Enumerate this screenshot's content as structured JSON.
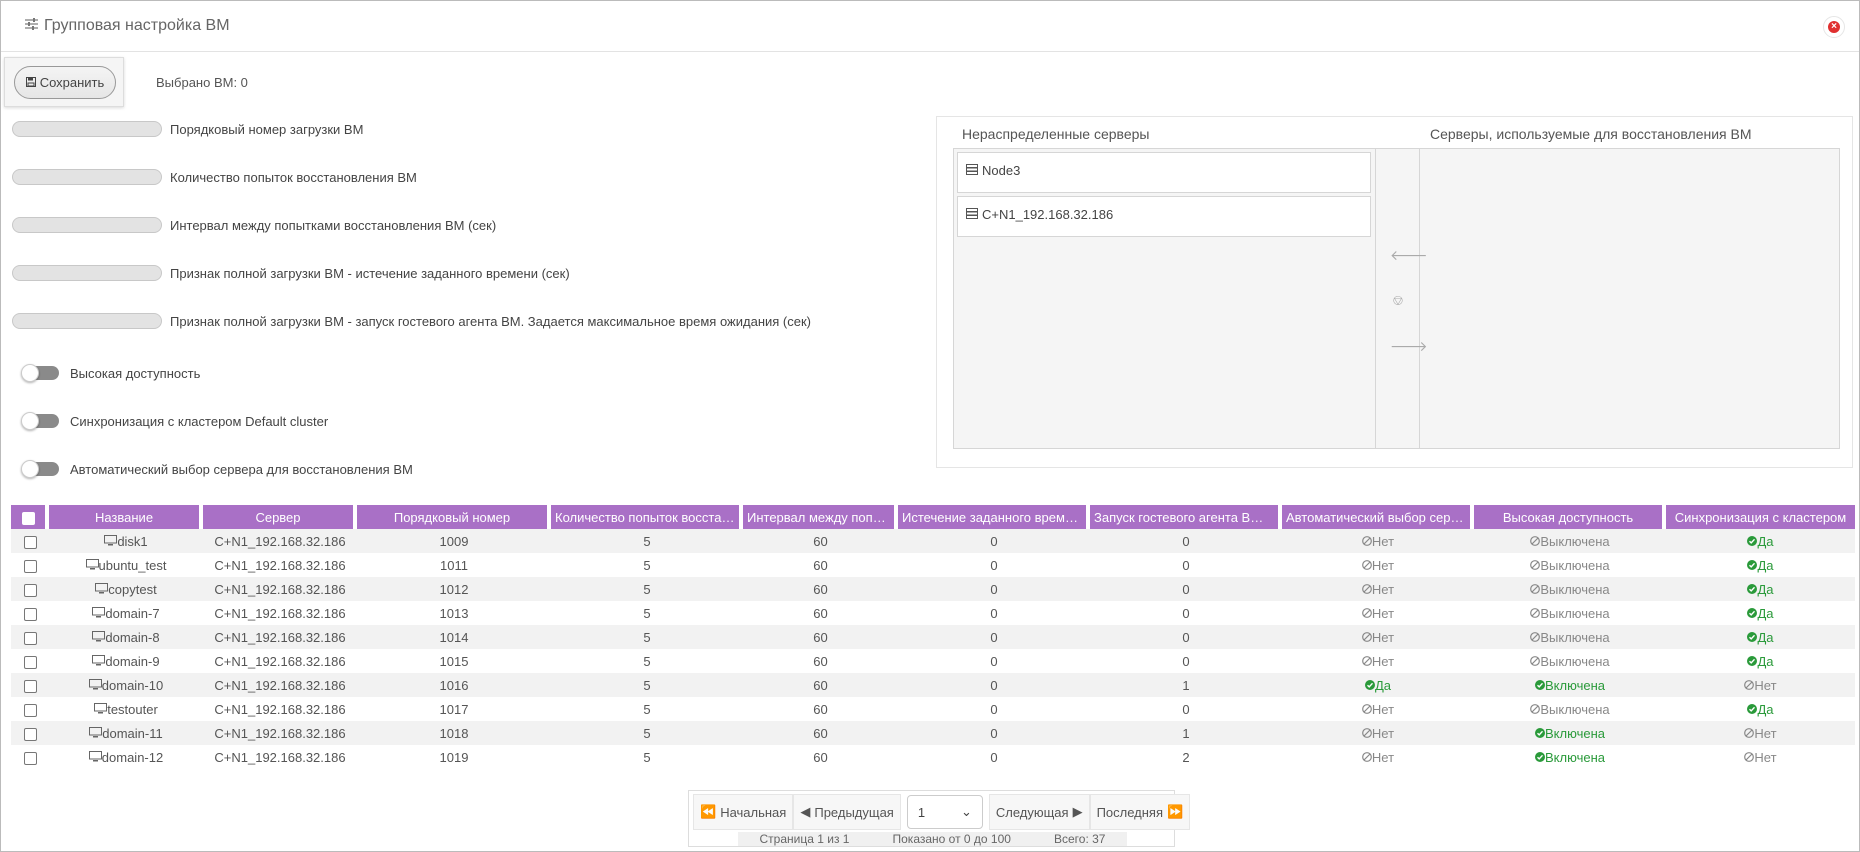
{
  "window": {
    "title": "Групповая настройка ВМ",
    "title_icon": "sliders-icon",
    "close_icon": "close-icon"
  },
  "toolbar": {
    "save_label": "Сохранить",
    "save_icon": "floppy-icon",
    "selected_label": "Выбрано ВМ: 0"
  },
  "fields": [
    "Порядковый номер загрузки ВМ",
    "Количество попыток восстановления ВМ",
    "Интервал между попытками восстановления ВМ (сек)",
    "Признак полной загрузки ВМ - истечение заданного времени (сек)",
    "Признак полной загрузки ВМ - запуск гостевого агента ВМ. Задается максимальное время ожидания (сек)"
  ],
  "toggles": [
    "Высокая доступность",
    "Синхронизация с кластером Default cluster",
    "Автоматический выбор сервера для восстановления ВМ"
  ],
  "servers": {
    "unassigned_title": "Нераспределенные серверы",
    "used_title": "Серверы, используемые для восстановления ВМ",
    "unassigned": [
      "Node3",
      "C+N1_192.168.32.186"
    ],
    "used": []
  },
  "table": {
    "columns": [
      "Название",
      "Сервер",
      "Порядковый номер",
      "Количество попыток восстан...",
      "Интервал между попы...",
      "Истечение заданного време...",
      "Запуск гостевого агента ВМ ...",
      "Автоматический выбор серв...",
      "Высокая доступность",
      "Синхронизация с кластером"
    ],
    "rows": [
      {
        "name": "disk1",
        "server": "C+N1_192.168.32.186",
        "order": "1009",
        "attempts": "5",
        "interval": "60",
        "timeout": "0",
        "agent": "0",
        "auto": "Нет",
        "auto_ok": false,
        "ha": "Выключена",
        "ha_ok": false,
        "sync": "Да",
        "sync_ok": true
      },
      {
        "name": "ubuntu_test",
        "server": "C+N1_192.168.32.186",
        "order": "1011",
        "attempts": "5",
        "interval": "60",
        "timeout": "0",
        "agent": "0",
        "auto": "Нет",
        "auto_ok": false,
        "ha": "Выключена",
        "ha_ok": false,
        "sync": "Да",
        "sync_ok": true
      },
      {
        "name": "copytest",
        "server": "C+N1_192.168.32.186",
        "order": "1012",
        "attempts": "5",
        "interval": "60",
        "timeout": "0",
        "agent": "0",
        "auto": "Нет",
        "auto_ok": false,
        "ha": "Выключена",
        "ha_ok": false,
        "sync": "Да",
        "sync_ok": true
      },
      {
        "name": "domain-7",
        "server": "C+N1_192.168.32.186",
        "order": "1013",
        "attempts": "5",
        "interval": "60",
        "timeout": "0",
        "agent": "0",
        "auto": "Нет",
        "auto_ok": false,
        "ha": "Выключена",
        "ha_ok": false,
        "sync": "Да",
        "sync_ok": true
      },
      {
        "name": "domain-8",
        "server": "C+N1_192.168.32.186",
        "order": "1014",
        "attempts": "5",
        "interval": "60",
        "timeout": "0",
        "agent": "0",
        "auto": "Нет",
        "auto_ok": false,
        "ha": "Выключена",
        "ha_ok": false,
        "sync": "Да",
        "sync_ok": true
      },
      {
        "name": "domain-9",
        "server": "C+N1_192.168.32.186",
        "order": "1015",
        "attempts": "5",
        "interval": "60",
        "timeout": "0",
        "agent": "0",
        "auto": "Нет",
        "auto_ok": false,
        "ha": "Выключена",
        "ha_ok": false,
        "sync": "Да",
        "sync_ok": true
      },
      {
        "name": "domain-10",
        "server": "C+N1_192.168.32.186",
        "order": "1016",
        "attempts": "5",
        "interval": "60",
        "timeout": "0",
        "agent": "1",
        "auto": "Да",
        "auto_ok": true,
        "ha": "Включена",
        "ha_ok": true,
        "sync": "Нет",
        "sync_ok": false
      },
      {
        "name": "testouter",
        "server": "C+N1_192.168.32.186",
        "order": "1017",
        "attempts": "5",
        "interval": "60",
        "timeout": "0",
        "agent": "0",
        "auto": "Нет",
        "auto_ok": false,
        "ha": "Выключена",
        "ha_ok": false,
        "sync": "Да",
        "sync_ok": true
      },
      {
        "name": "domain-11",
        "server": "C+N1_192.168.32.186",
        "order": "1018",
        "attempts": "5",
        "interval": "60",
        "timeout": "0",
        "agent": "1",
        "auto": "Нет",
        "auto_ok": false,
        "ha": "Включена",
        "ha_ok": true,
        "sync": "Нет",
        "sync_ok": false
      },
      {
        "name": "domain-12",
        "server": "C+N1_192.168.32.186",
        "order": "1019",
        "attempts": "5",
        "interval": "60",
        "timeout": "0",
        "agent": "2",
        "auto": "Нет",
        "auto_ok": false,
        "ha": "Включена",
        "ha_ok": true,
        "sync": "Нет",
        "sync_ok": false
      }
    ]
  },
  "pager": {
    "first": "Начальная",
    "prev": "Предыдущая",
    "page": "1",
    "next": "Следующая",
    "last": "Последняя",
    "page_info": "Страница 1 из 1",
    "shown": "Показано от 0 до 100",
    "total": "Всего: 37"
  },
  "colors": {
    "header_bg": "#a970c6",
    "ok": "#2a9a3a",
    "close": "#e03030"
  }
}
